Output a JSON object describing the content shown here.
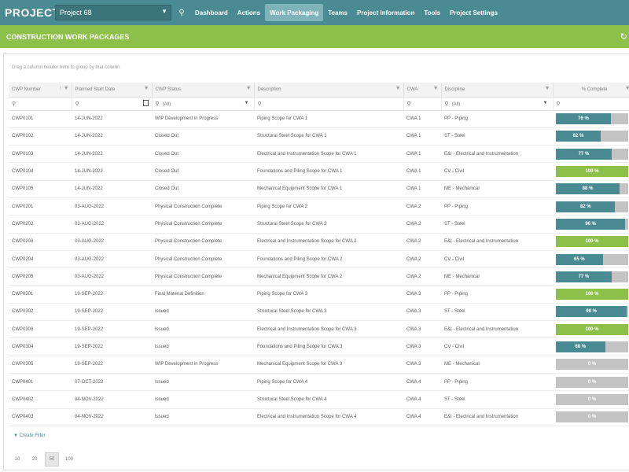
{
  "app": {
    "brand": "PROJECTS",
    "project": "Project 68"
  },
  "nav": [
    {
      "label": "Dashboard",
      "active": false
    },
    {
      "label": "Actions",
      "active": false
    },
    {
      "label": "Work Packaging",
      "active": true
    },
    {
      "label": "Teams",
      "active": false
    },
    {
      "label": "Project Information",
      "active": false
    },
    {
      "label": "Tools",
      "active": false
    },
    {
      "label": "Project Settings",
      "active": false
    }
  ],
  "page": {
    "title": "CONSTRUCTION WORK PACKAGES",
    "group_hint": "Drag a column header here to group by that column"
  },
  "columns": [
    "CWP Number",
    "Planned Start Date",
    "CWP Status",
    "Description",
    "CWA",
    "Discipline",
    "% Complete"
  ],
  "filters": {
    "status_all": "(All)",
    "discipline_all": "(All)"
  },
  "colors": {
    "teal": "#4a8a93",
    "green": "#8cc04b",
    "gray": "#c3c3c3"
  },
  "rows": [
    {
      "cwp": "CWP0101",
      "date": "14-JUN-2022",
      "status": "WIP Development in Progress",
      "desc": "Piping Scope for CWA 1",
      "cwa": "CWA 1",
      "disc": "PP - Piping",
      "pct": 76,
      "pct_label": "76 %",
      "color": "teal"
    },
    {
      "cwp": "CWP0102",
      "date": "14-JUN-2022",
      "status": "Closed Out",
      "desc": "Structural Steel Scope for CWA 1",
      "cwa": "CWA 1",
      "disc": "ST - Steel",
      "pct": 62,
      "pct_label": "62 %",
      "color": "teal"
    },
    {
      "cwp": "CWP0103",
      "date": "14-JUN-2022",
      "status": "Closed Out",
      "desc": "Electrical and Instrumentation Scope for CWA 1",
      "cwa": "CWA 1",
      "disc": "E&I - Electrical and Instrumentation",
      "pct": 77,
      "pct_label": "77 %",
      "color": "teal"
    },
    {
      "cwp": "CWP0104",
      "date": "14-JUN-2022",
      "status": "Closed Out",
      "desc": "Foundations and Piling Scope for CWA 1",
      "cwa": "CWA 1",
      "disc": "CV - Civil",
      "pct": 100,
      "pct_label": "100 %",
      "color": "green"
    },
    {
      "cwp": "CWP0105",
      "date": "14-JUN-2022",
      "status": "Closed Out",
      "desc": "Mechanical Equipment Scope for CWA 1",
      "cwa": "CWA 1",
      "disc": "ME - Mechanical",
      "pct": 88,
      "pct_label": "88 %",
      "color": "teal"
    },
    {
      "cwp": "CWP0201",
      "date": "03-AUG-2022",
      "status": "Physical Construction Complete",
      "desc": "Piping Scope for CWA 2",
      "cwa": "CWA 2",
      "disc": "PP - Piping",
      "pct": 82,
      "pct_label": "82 %",
      "color": "teal"
    },
    {
      "cwp": "CWP0202",
      "date": "03-AUG-2022",
      "status": "Physical Construction Complete",
      "desc": "Structural Steel Scope for CWA 2",
      "cwa": "CWA 2",
      "disc": "ST - Steel",
      "pct": 96,
      "pct_label": "96 %",
      "color": "teal"
    },
    {
      "cwp": "CWP0203",
      "date": "03-AUG-2022",
      "status": "Physical Construction Complete",
      "desc": "Electrical and Instrumentation Scope for CWA 2",
      "cwa": "CWA 2",
      "disc": "E&I - Electrical and Instrumentation",
      "pct": 100,
      "pct_label": "100 %",
      "color": "green"
    },
    {
      "cwp": "CWP0204",
      "date": "03-AUG-2022",
      "status": "Physical Construction Complete",
      "desc": "Foundations and Piling Scope for CWA 2",
      "cwa": "CWA 2",
      "disc": "CV - Civil",
      "pct": 65,
      "pct_label": "65 %",
      "color": "teal"
    },
    {
      "cwp": "CWP0205",
      "date": "03-AUG-2022",
      "status": "Physical Construction Complete",
      "desc": "Mechanical Equipment Scope for CWA 2",
      "cwa": "CWA 2",
      "disc": "ME - Mechanical",
      "pct": 77,
      "pct_label": "77 %",
      "color": "teal"
    },
    {
      "cwp": "CWP0301",
      "date": "19-SEP-2022",
      "status": "Final Material Definition",
      "desc": "Piping Scope for CWA 3",
      "cwa": "CWA 3",
      "disc": "PP - Piping",
      "pct": 100,
      "pct_label": "100 %",
      "color": "green"
    },
    {
      "cwp": "CWP0302",
      "date": "19-SEP-2022",
      "status": "Issued",
      "desc": "Structural Steel Scope for CWA 3",
      "cwa": "CWA 3",
      "disc": "ST - Steel",
      "pct": 98,
      "pct_label": "98 %",
      "color": "teal"
    },
    {
      "cwp": "CWP0303",
      "date": "19-SEP-2022",
      "status": "Issued",
      "desc": "Electrical and Instrumentation Scope for CWA 3",
      "cwa": "CWA 3",
      "disc": "E&I - Electrical and Instrumentation",
      "pct": 100,
      "pct_label": "100 %",
      "color": "green"
    },
    {
      "cwp": "CWP0304",
      "date": "19-SEP-2022",
      "status": "Issued",
      "desc": "Foundations and Piling Scope for CWA 3",
      "cwa": "CWA 3",
      "disc": "CV - Civil",
      "pct": 68,
      "pct_label": "68 %",
      "color": "teal"
    },
    {
      "cwp": "CWP0305",
      "date": "19-SEP-2022",
      "status": "WIP Development in Progress",
      "desc": "Mechanical Equipment Scope for CWA 3",
      "cwa": "CWA 3",
      "disc": "ME - Mechanical",
      "pct": 0,
      "pct_label": "0 %",
      "color": "gray"
    },
    {
      "cwp": "CWP0401",
      "date": "07-OCT-2022",
      "status": "Issued",
      "desc": "Piping Scope for CWA 4",
      "cwa": "CWA 4",
      "disc": "PP - Piping",
      "pct": 0,
      "pct_label": "0 %",
      "color": "gray"
    },
    {
      "cwp": "CWP0402",
      "date": "04-NOV-2022",
      "status": "Issued",
      "desc": "Structural Steel Scope for CWA 4",
      "cwa": "CWA 4",
      "disc": "ST - Steel",
      "pct": 0,
      "pct_label": "0 %",
      "color": "gray"
    },
    {
      "cwp": "CWP0403",
      "date": "04-NOV-2022",
      "status": "Issued",
      "desc": "Electrical and Instrumentation Scope for CWA 4",
      "cwa": "CWA 4",
      "disc": "E&I - Electrical and Instrumentation",
      "pct": 0,
      "pct_label": "0 %",
      "color": "gray"
    }
  ],
  "footer": {
    "create_filter": "Create Filter",
    "page_sizes": [
      "10",
      "20",
      "50",
      "100"
    ],
    "selected_page_size": "50"
  }
}
